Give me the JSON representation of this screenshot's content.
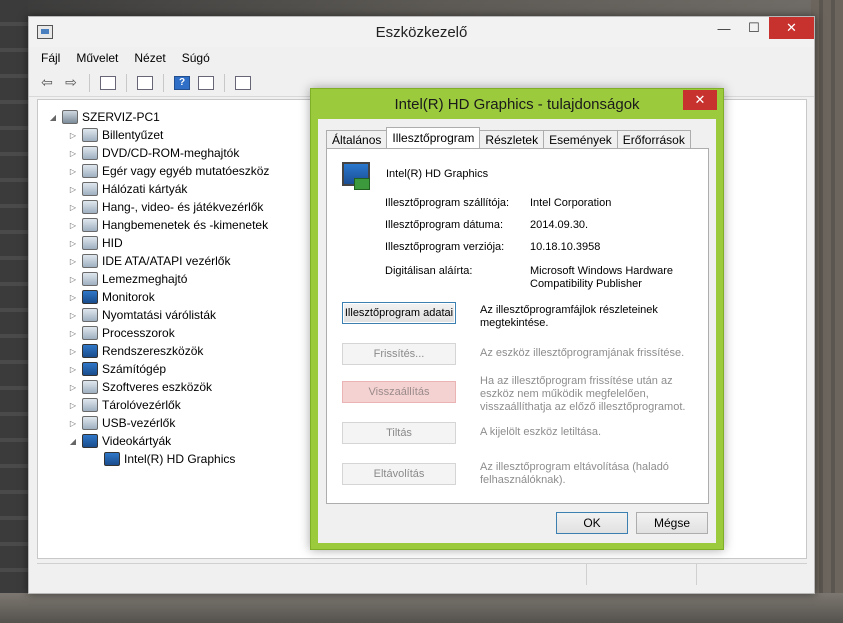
{
  "main_window": {
    "title": "Eszközkezelő",
    "controls": {
      "minimize": "—",
      "maximize": "☐",
      "close": "✕"
    }
  },
  "menu": [
    "Fájl",
    "Művelet",
    "Nézet",
    "Súgó"
  ],
  "toolbar": {
    "back_icon": "arrow-left-icon",
    "forward_icon": "arrow-right-icon",
    "help_glyph": "?"
  },
  "tree": {
    "root": "SZERVIZ-PC1",
    "categories": [
      "Billentyűzet",
      "DVD/CD-ROM-meghajtók",
      "Egér vagy egyéb mutatóeszköz",
      "Hálózati kártyák",
      "Hang-, video- és játékvezérlők",
      "Hangbemenetek és -kimenetek",
      "HID",
      "IDE ATA/ATAPI vezérlők",
      "Lemezmeghajtó",
      "Monitorok",
      "Nyomtatási várólisták",
      "Processzorok",
      "Rendszereszközök",
      "Számítógép",
      "Szoftveres eszközök",
      "Tárolóvezérlők",
      "USB-vezérlők",
      "Videokártyák"
    ],
    "expanded_child": "Intel(R) HD Graphics"
  },
  "dialog": {
    "title": "Intel(R) HD Graphics - tulajdonságok",
    "close": "✕",
    "tabs": [
      "Általános",
      "Illesztőprogram",
      "Részletek",
      "Események",
      "Erőforrások"
    ],
    "active_tab": "Illesztőprogram",
    "device_name": "Intel(R) HD Graphics",
    "properties": [
      {
        "label": "Illesztőprogram szállítója:",
        "value": "Intel Corporation"
      },
      {
        "label": "Illesztőprogram dátuma:",
        "value": "2014.09.30."
      },
      {
        "label": "Illesztőprogram verziója:",
        "value": "10.18.10.3958"
      },
      {
        "label": "Digitálisan aláírta:",
        "value": "Microsoft Windows Hardware Compatibility Publisher"
      }
    ],
    "actions": [
      {
        "label": "Illesztőprogram adatai",
        "desc": "Az illesztőprogramfájlok részleteinek megtekintése.",
        "state": "enabled"
      },
      {
        "label": "Frissítés...",
        "desc": "Az eszköz illesztőprogramjának frissítése.",
        "state": "disabled"
      },
      {
        "label": "Visszaállítás",
        "desc": "Ha az illesztőprogram frissítése után az eszköz nem működik megfelelően, visszaállíthatja az előző illesztőprogramot.",
        "state": "highlighted-disabled"
      },
      {
        "label": "Tiltás",
        "desc": "A kijelölt eszköz letiltása.",
        "state": "disabled"
      },
      {
        "label": "Eltávolítás",
        "desc": "Az illesztőprogram eltávolítása (haladó felhasználóknak).",
        "state": "disabled"
      }
    ],
    "ok": "OK",
    "cancel": "Mégse",
    "accent_color": "#9bcb3d"
  }
}
